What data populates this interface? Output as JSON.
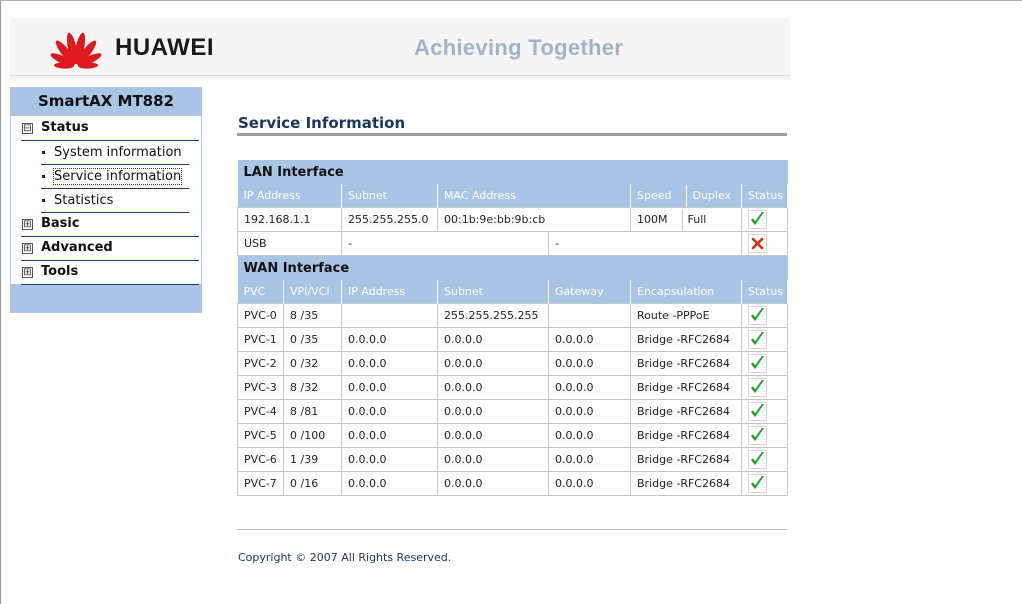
{
  "header": {
    "brand": "HUAWEI",
    "tagline": "Achieving Together",
    "colors": {
      "logo": "#e0191f",
      "tagline": "#9fb4cc"
    }
  },
  "sidebar": {
    "title": "SmartAX MT882",
    "groups": [
      {
        "label": "Status",
        "expander": "⊟",
        "items": [
          {
            "label": "System information",
            "active": false
          },
          {
            "label": "Service information",
            "active": true
          },
          {
            "label": "Statistics",
            "active": false
          }
        ]
      },
      {
        "label": "Basic",
        "expander": "⊞"
      },
      {
        "label": "Advanced",
        "expander": "⊞"
      },
      {
        "label": "Tools",
        "expander": "⊞"
      }
    ]
  },
  "main": {
    "title": "Service Information",
    "lan": {
      "section": "LAN Interface",
      "headers": [
        "IP Address",
        "Subnet",
        "MAC Address",
        "Speed",
        "Duplex",
        "Status"
      ],
      "rows": [
        {
          "ip": "192.168.1.1",
          "subnet": "255.255.255.0",
          "mac": "00:1b:9e:bb:9b:cb",
          "speed": "100M",
          "duplex": "Full",
          "status": "check-icon"
        },
        {
          "ip": "USB",
          "subnet": "-",
          "mac": "-",
          "speed": "",
          "duplex": "",
          "status": "cross-icon"
        }
      ]
    },
    "wan": {
      "section": "WAN Interface",
      "headers": [
        "PVC",
        "VPI/VCI",
        "IP Address",
        "Subnet",
        "Gateway",
        "Encapsulation",
        "Status"
      ],
      "rows": [
        {
          "pvc": "PVC-0",
          "vpivci": "8 /35",
          "ip": "",
          "subnet": "255.255.255.255",
          "gateway": "",
          "encap": "Route -PPPoE"
        },
        {
          "pvc": "PVC-1",
          "vpivci": "0 /35",
          "ip": "0.0.0.0",
          "subnet": "0.0.0.0",
          "gateway": "0.0.0.0",
          "encap": "Bridge -RFC2684"
        },
        {
          "pvc": "PVC-2",
          "vpivci": "0 /32",
          "ip": "0.0.0.0",
          "subnet": "0.0.0.0",
          "gateway": "0.0.0.0",
          "encap": "Bridge -RFC2684"
        },
        {
          "pvc": "PVC-3",
          "vpivci": "8 /32",
          "ip": "0.0.0.0",
          "subnet": "0.0.0.0",
          "gateway": "0.0.0.0",
          "encap": "Bridge -RFC2684"
        },
        {
          "pvc": "PVC-4",
          "vpivci": "8 /81",
          "ip": "0.0.0.0",
          "subnet": "0.0.0.0",
          "gateway": "0.0.0.0",
          "encap": "Bridge -RFC2684"
        },
        {
          "pvc": "PVC-5",
          "vpivci": "0 /100",
          "ip": "0.0.0.0",
          "subnet": "0.0.0.0",
          "gateway": "0.0.0.0",
          "encap": "Bridge -RFC2684"
        },
        {
          "pvc": "PVC-6",
          "vpivci": "1 /39",
          "ip": "0.0.0.0",
          "subnet": "0.0.0.0",
          "gateway": "0.0.0.0",
          "encap": "Bridge -RFC2684"
        },
        {
          "pvc": "PVC-7",
          "vpivci": "0 /16",
          "ip": "0.0.0.0",
          "subnet": "0.0.0.0",
          "gateway": "0.0.0.0",
          "encap": "Bridge -RFC2684"
        }
      ]
    }
  },
  "footer": {
    "copyright": "Copyright © 2007 All Rights Reserved."
  },
  "icons": {
    "ok": "check-icon",
    "error": "cross-icon"
  },
  "colors": {
    "section_bg": "#aac4e5",
    "title": "#17375e",
    "ok": "#12a112",
    "error": "#d42a16"
  }
}
